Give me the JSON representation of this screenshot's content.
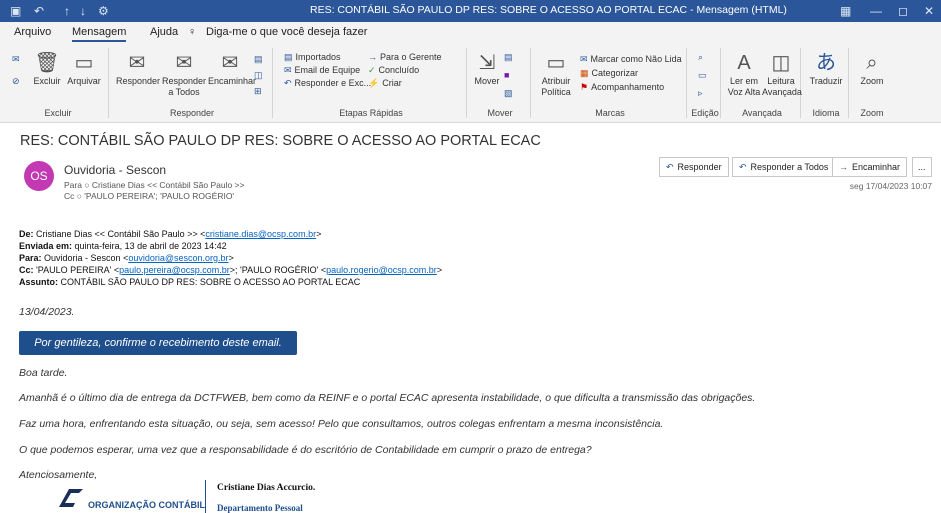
{
  "window": {
    "title": "RES: CONTÁBIL SÃO PAULO DP RES: SOBRE O ACESSO AO PORTAL ECAC  -  Mensagem (HTML)"
  },
  "menu": {
    "items": [
      "Arquivo",
      "Mensagem",
      "Ajuda"
    ],
    "tell_me": "Diga-me o que você deseja fazer"
  },
  "ribbon": {
    "excluir": {
      "excluir": "Excluir",
      "arquivar": "Arquivar",
      "group": "Excluir"
    },
    "responder": {
      "responder": "Responder",
      "responder_todos": "Responder a Todos",
      "encaminhar": "Encaminhar",
      "group": "Responder"
    },
    "etapas": {
      "items": [
        "Importados",
        "Email de Equipe",
        "Responder e Exc...",
        "Para o Gerente",
        "Concluído",
        "Criar"
      ],
      "group": "Etapas Rápidas"
    },
    "mover": {
      "label": "Mover",
      "group": "Mover"
    },
    "marcas": {
      "atribuir": "Atribuir Política",
      "marcar": "Marcar como Não Lida",
      "categorizar": "Categorizar",
      "acompanhamento": "Acompanhamento",
      "group": "Marcas"
    },
    "edicao": {
      "group": "Edição"
    },
    "avancada": {
      "ler": "Ler em Voz Alta",
      "leitura": "Leitura Avançada",
      "group": "Avançada"
    },
    "idioma": {
      "traduzir": "Traduzir",
      "group": "Idioma"
    },
    "zoom": {
      "label": "Zoom",
      "group": "Zoom"
    }
  },
  "message": {
    "subject": "RES: CONTÁBIL SÃO PAULO DP RES: SOBRE O ACESSO AO PORTAL ECAC",
    "avatar": "OS",
    "sender": "Ouvidoria - Sescon",
    "to_label": "Para",
    "to": "Cristiane Dias << Contábil São Paulo >>",
    "cc_label": "Cc",
    "cc": "'PAULO PEREIRA';  'PAULO ROGÉRIO'",
    "date": "seg 17/04/2023 10:07",
    "actions": {
      "responder": "Responder",
      "responder_todos": "Responder a Todos",
      "encaminhar": "Encaminhar",
      "more": "..."
    }
  },
  "header": {
    "de_label": "De:",
    "de": "Cristiane Dias << Contábil São Paulo >> <",
    "de_email": "cristiane.dias@ocsp.com.br",
    "de_end": ">",
    "enviada_label": "Enviada em:",
    "enviada": "quinta-feira, 13 de abril de 2023 14:42",
    "para_label": "Para:",
    "para": "Ouvidoria - Sescon <",
    "para_email": "ouvidoria@sescon.org.br",
    "para_end": ">",
    "cc_label": "Cc:",
    "cc1": "'PAULO PEREIRA' <",
    "cc1_email": "paulo.pereira@ocsp.com.br",
    "cc_mid": ">; 'PAULO ROGÉRIO' <",
    "cc2_email": "paulo.rogerio@ocsp.com.br",
    "cc_end": ">",
    "assunto_label": "Assunto:",
    "assunto": "CONTÁBIL SÃO PAULO DP RES: SOBRE O ACESSO AO PORTAL ECAC"
  },
  "body": {
    "date": "13/04/2023.",
    "confirm": "Por gentileza, confirme o recebimento deste email.",
    "greeting": "Boa tarde.",
    "p1": "Amanhã é o último dia de entrega da DCTFWEB, bem como da REINF e o portal ECAC apresenta instabilidade, o que dificulta a transmissão das obrigações.",
    "p2": "Faz uma hora, enfrentando esta situação, ou seja, sem acesso! Pelo que consultamos, outros colegas enfrentam a mesma inconsistência.",
    "p3": "O que podemos esperar, uma vez que a responsabilidade é do escritório de Contabilidade em cumprir o prazo de entrega?",
    "closing": "Atenciosamente,"
  },
  "signature": {
    "name": "Cristiane Dias Accurcio.",
    "dept": "Departamento Pessoal",
    "org": "ORGANIZAÇÃO CONTÁBIL"
  }
}
